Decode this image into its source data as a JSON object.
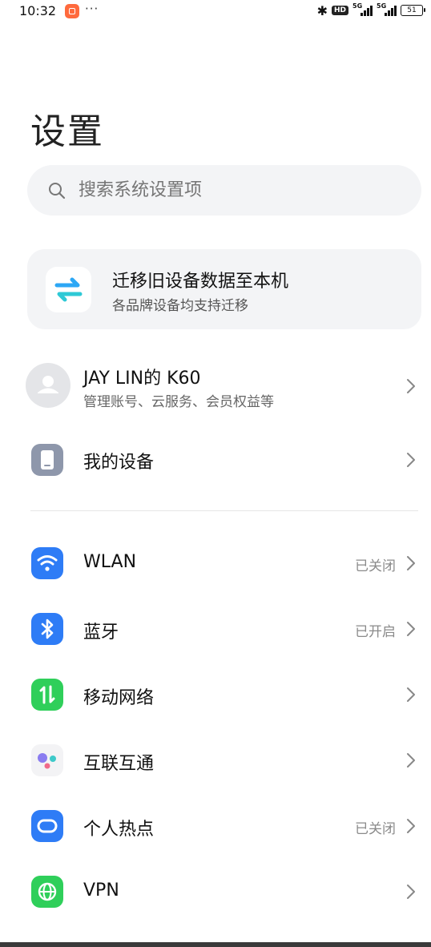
{
  "status_bar": {
    "time": "10:32",
    "more": "···",
    "hd_badge": "HD",
    "net1": "5G",
    "net2": "5G",
    "battery": "51"
  },
  "page": {
    "title": "设置"
  },
  "search": {
    "placeholder": "搜索系统设置项"
  },
  "migrate_card": {
    "title": "迁移旧设备数据至本机",
    "subtitle": "各品牌设备均支持迁移"
  },
  "account": {
    "name": "JAY LIN的 K60",
    "subtitle": "管理账号、云服务、会员权益等"
  },
  "my_device": {
    "label": "我的设备"
  },
  "settings": [
    {
      "label": "WLAN",
      "status": "已关闭",
      "icon": "wifi-icon",
      "color": "#2e7cf6"
    },
    {
      "label": "蓝牙",
      "status": "已开启",
      "icon": "bluetooth-icon",
      "color": "#2e7cf6"
    },
    {
      "label": "移动网络",
      "status": "",
      "icon": "mobile-data-icon",
      "color": "#2fcf5a"
    },
    {
      "label": "互联互通",
      "status": "",
      "icon": "interconnect-icon",
      "color": "#f3f3f5"
    },
    {
      "label": "个人热点",
      "status": "已关闭",
      "icon": "hotspot-icon",
      "color": "#2e7cf6"
    },
    {
      "label": "VPN",
      "status": "",
      "icon": "vpn-icon",
      "color": "#2fcf5a"
    }
  ]
}
